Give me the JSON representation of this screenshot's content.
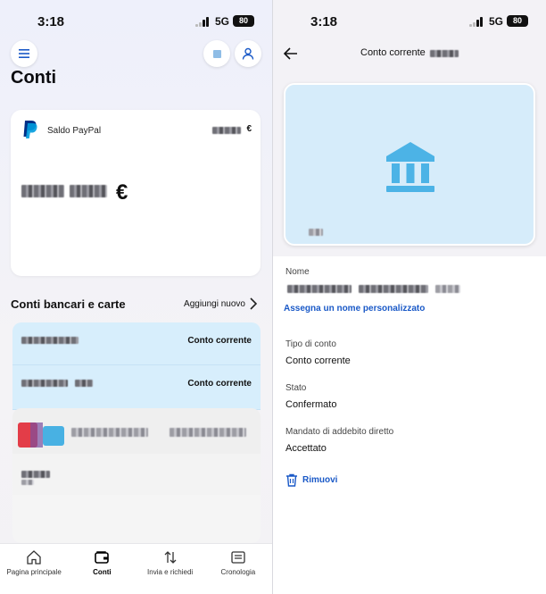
{
  "left_screen": {
    "status": {
      "time": "3:18",
      "network": "5G",
      "battery": "80"
    },
    "title": "Conti",
    "paypal_card": {
      "label": "Saldo PayPal",
      "currency_small": "€",
      "currency_big": "€"
    },
    "bank_section": {
      "title": "Conti bancari e carte",
      "add_label": "Aggiungi nuovo",
      "accounts": [
        {
          "type": "Conto corrente"
        },
        {
          "type": "Conto corrente"
        }
      ]
    },
    "bottom_nav": [
      {
        "label": "Pagina principale",
        "icon": "home-icon",
        "active": false
      },
      {
        "label": "Conti",
        "icon": "wallet-icon",
        "active": true
      },
      {
        "label": "Invia e richiedi",
        "icon": "transfer-arrows-icon",
        "active": false
      },
      {
        "label": "Cronologia",
        "icon": "history-icon",
        "active": false
      }
    ]
  },
  "right_screen": {
    "status": {
      "time": "3:18",
      "network": "5G",
      "battery": "80"
    },
    "title": "Conto corrente",
    "fields": {
      "name_label": "Nome",
      "rename_link": "Assegna un nome personalizzato",
      "type_label": "Tipo di conto",
      "type_value": "Conto corrente",
      "state_label": "Stato",
      "state_value": "Confermato",
      "mandate_label": "Mandato di addebito diretto",
      "mandate_value": "Accettato"
    },
    "remove_label": "Rimuovi"
  },
  "colors": {
    "accent_blue": "#1a59c7",
    "bank_card_bg": "#d6ecfa",
    "bank_icon": "#4cb3e6",
    "paypal_navy": "#003087",
    "paypal_blue": "#009cde"
  }
}
